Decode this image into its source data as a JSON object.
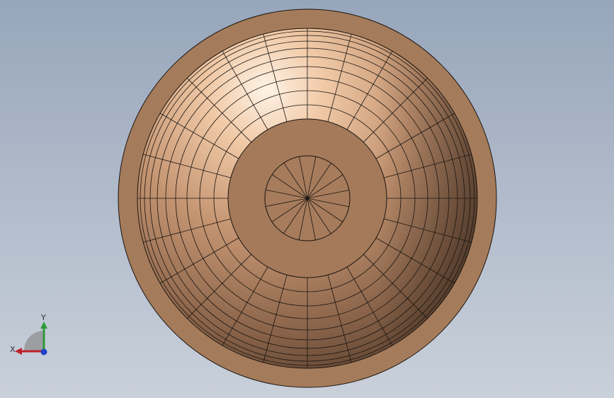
{
  "viewport": {
    "model": {
      "name": "bowl",
      "color_rim": "#a07a59",
      "color_base": "#a9805e",
      "color_highlight": "#fbe9d6",
      "color_shadow": "#5b4232",
      "edge_color": "#1a1410"
    }
  },
  "triad": {
    "x_label": "X",
    "y_label": "Y",
    "x_color": "#c0202a",
    "y_color": "#2e9a3a",
    "z_color": "#2242c8"
  }
}
